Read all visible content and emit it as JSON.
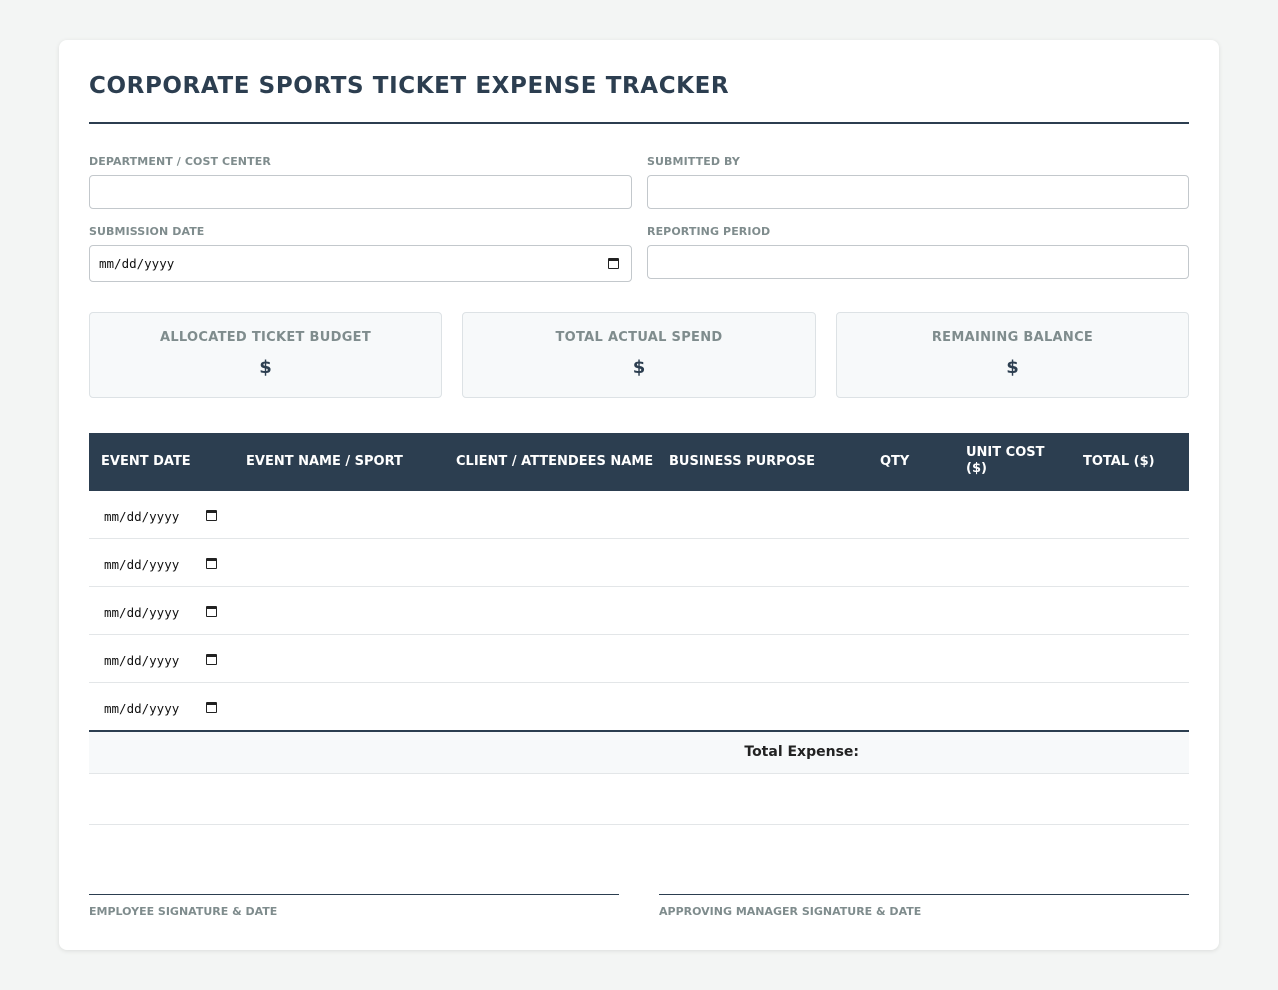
{
  "form": {
    "title": "CORPORATE SPORTS TICKET EXPENSE TRACKER",
    "fields": {
      "department": {
        "label": "DEPARTMENT / COST CENTER",
        "value": ""
      },
      "submitted_by": {
        "label": "SUBMITTED BY",
        "value": ""
      },
      "submission_date": {
        "label": "SUBMISSION DATE",
        "placeholder": "mm/dd/yyyy"
      },
      "reporting_period": {
        "label": "REPORTING PERIOD",
        "value": ""
      }
    }
  },
  "summary": {
    "budget": {
      "label": "ALLOCATED TICKET BUDGET",
      "value": "$"
    },
    "spend": {
      "label": "TOTAL ACTUAL SPEND",
      "value": "$"
    },
    "balance": {
      "label": "REMAINING BALANCE",
      "value": "$"
    }
  },
  "table": {
    "headers": {
      "event_date": "EVENT DATE",
      "event_name": "EVENT NAME / SPORT",
      "client": "CLIENT / ATTENDEES NAME",
      "purpose": "BUSINESS PURPOSE",
      "qty": "QTY",
      "unit_cost": "UNIT COST ($)",
      "total": "TOTAL ($)"
    },
    "rows": [
      {
        "date": "mm/dd/yyyy"
      },
      {
        "date": "mm/dd/yyyy"
      },
      {
        "date": "mm/dd/yyyy"
      },
      {
        "date": "mm/dd/yyyy"
      },
      {
        "date": "mm/dd/yyyy"
      }
    ],
    "total_label": "Total Expense:"
  },
  "signatures": {
    "employee": "EMPLOYEE SIGNATURE & DATE",
    "manager": "APPROVING MANAGER SIGNATURE & DATE"
  }
}
